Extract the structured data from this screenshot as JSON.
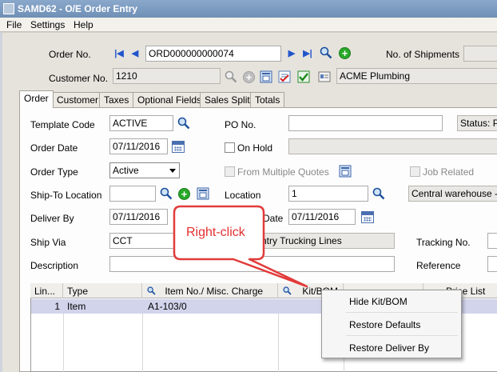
{
  "window": {
    "title": "SAMD62 - O/E Order Entry"
  },
  "menu": [
    "File",
    "Settings",
    "Help"
  ],
  "header": {
    "order_no_label": "Order No.",
    "order_no_value": "ORD000000000074",
    "shipments_label": "No. of Shipments",
    "customer_no_label": "Customer No.",
    "customer_no_value": "1210",
    "customer_name": "ACME Plumbing"
  },
  "tabs": [
    "Order",
    "Customer",
    "Taxes",
    "Optional Fields",
    "Sales Split",
    "Totals"
  ],
  "form": {
    "template_code_label": "Template Code",
    "template_code_value": "ACTIVE",
    "po_no_label": "PO No.",
    "status_label": "Status: P",
    "order_date_label": "Order Date",
    "order_date_value": "07/11/2016",
    "on_hold_label": "On Hold",
    "order_type_label": "Order Type",
    "order_type_value": "Active",
    "from_quotes_label": "From Multiple Quotes",
    "job_related_label": "Job Related",
    "ship_to_label": "Ship-To Location",
    "location_label": "Location",
    "location_value": "1",
    "location_desc": "Central warehouse - Se",
    "deliver_by_label": "Deliver By",
    "deliver_by_value": "07/11/2016",
    "date_label": "Date",
    "date_value": "07/11/2016",
    "ship_via_label": "Ship Via",
    "ship_via_value": "CCT",
    "ship_via_desc": "ntry Trucking Lines",
    "tracking_label": "Tracking No.",
    "description_label": "Description",
    "reference_label": "Reference"
  },
  "grid": {
    "headers": {
      "line": "Lin...",
      "type": "Type",
      "item": "Item No./ Misc. Charge",
      "kit": "Kit/BOM",
      "price_list": "Price List"
    },
    "rows": [
      {
        "line": "1",
        "type": "Item",
        "item": "A1-103/0"
      }
    ]
  },
  "context_menu": [
    "Hide Kit/BOM",
    "Restore Defaults",
    "Restore Deliver By"
  ],
  "callout": {
    "text": "Right-click",
    "color": "#e53030"
  }
}
